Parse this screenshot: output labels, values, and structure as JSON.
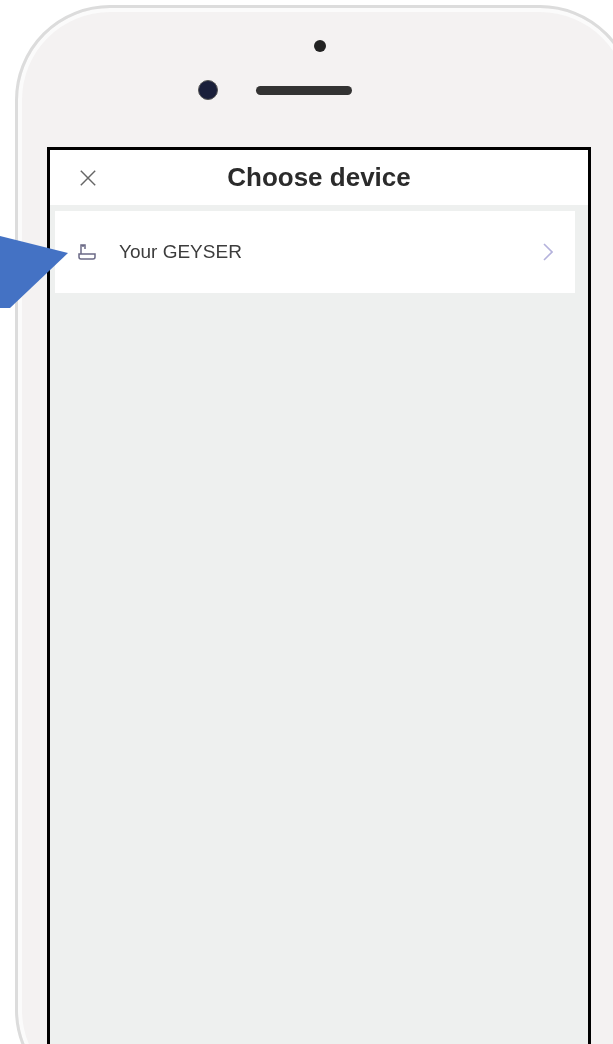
{
  "header": {
    "title": "Choose device"
  },
  "devices": [
    {
      "label": "Your GEYSER"
    }
  ]
}
